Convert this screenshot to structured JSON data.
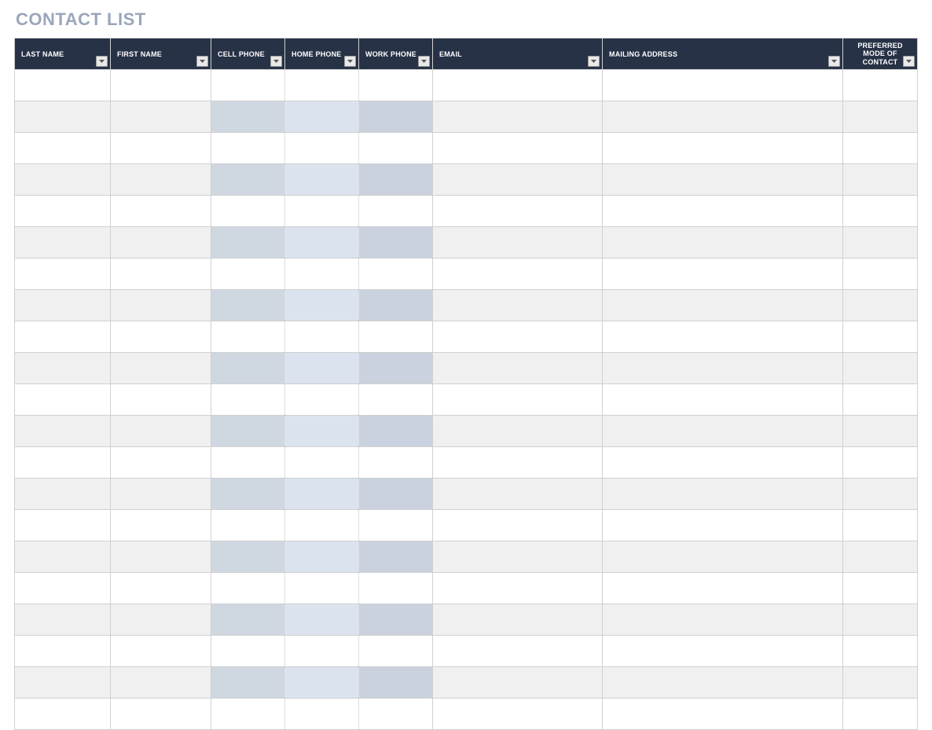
{
  "title": "CONTACT LIST",
  "columns": [
    {
      "key": "last_name",
      "label": "LAST NAME",
      "align": "left",
      "filter": true
    },
    {
      "key": "first_name",
      "label": "FIRST NAME",
      "align": "left",
      "filter": true
    },
    {
      "key": "cell_phone",
      "label": "CELL PHONE",
      "align": "left",
      "filter": true
    },
    {
      "key": "home_phone",
      "label": "HOME PHONE",
      "align": "left",
      "filter": true
    },
    {
      "key": "work_phone",
      "label": "WORK PHONE",
      "align": "left",
      "filter": true
    },
    {
      "key": "email",
      "label": "EMAIL",
      "align": "left",
      "filter": true
    },
    {
      "key": "mailing_address",
      "label": "MAILING ADDRESS",
      "align": "left",
      "filter": true
    },
    {
      "key": "preferred_mode",
      "label": "PREFERRED MODE OF CONTACT",
      "align": "center",
      "filter": true
    }
  ],
  "rows": [
    {
      "last_name": "",
      "first_name": "",
      "cell_phone": "",
      "home_phone": "",
      "work_phone": "",
      "email": "",
      "mailing_address": "",
      "preferred_mode": ""
    },
    {
      "last_name": "",
      "first_name": "",
      "cell_phone": "",
      "home_phone": "",
      "work_phone": "",
      "email": "",
      "mailing_address": "",
      "preferred_mode": ""
    },
    {
      "last_name": "",
      "first_name": "",
      "cell_phone": "",
      "home_phone": "",
      "work_phone": "",
      "email": "",
      "mailing_address": "",
      "preferred_mode": ""
    },
    {
      "last_name": "",
      "first_name": "",
      "cell_phone": "",
      "home_phone": "",
      "work_phone": "",
      "email": "",
      "mailing_address": "",
      "preferred_mode": ""
    },
    {
      "last_name": "",
      "first_name": "",
      "cell_phone": "",
      "home_phone": "",
      "work_phone": "",
      "email": "",
      "mailing_address": "",
      "preferred_mode": ""
    },
    {
      "last_name": "",
      "first_name": "",
      "cell_phone": "",
      "home_phone": "",
      "work_phone": "",
      "email": "",
      "mailing_address": "",
      "preferred_mode": ""
    },
    {
      "last_name": "",
      "first_name": "",
      "cell_phone": "",
      "home_phone": "",
      "work_phone": "",
      "email": "",
      "mailing_address": "",
      "preferred_mode": ""
    },
    {
      "last_name": "",
      "first_name": "",
      "cell_phone": "",
      "home_phone": "",
      "work_phone": "",
      "email": "",
      "mailing_address": "",
      "preferred_mode": ""
    },
    {
      "last_name": "",
      "first_name": "",
      "cell_phone": "",
      "home_phone": "",
      "work_phone": "",
      "email": "",
      "mailing_address": "",
      "preferred_mode": ""
    },
    {
      "last_name": "",
      "first_name": "",
      "cell_phone": "",
      "home_phone": "",
      "work_phone": "",
      "email": "",
      "mailing_address": "",
      "preferred_mode": ""
    },
    {
      "last_name": "",
      "first_name": "",
      "cell_phone": "",
      "home_phone": "",
      "work_phone": "",
      "email": "",
      "mailing_address": "",
      "preferred_mode": ""
    },
    {
      "last_name": "",
      "first_name": "",
      "cell_phone": "",
      "home_phone": "",
      "work_phone": "",
      "email": "",
      "mailing_address": "",
      "preferred_mode": ""
    },
    {
      "last_name": "",
      "first_name": "",
      "cell_phone": "",
      "home_phone": "",
      "work_phone": "",
      "email": "",
      "mailing_address": "",
      "preferred_mode": ""
    },
    {
      "last_name": "",
      "first_name": "",
      "cell_phone": "",
      "home_phone": "",
      "work_phone": "",
      "email": "",
      "mailing_address": "",
      "preferred_mode": ""
    },
    {
      "last_name": "",
      "first_name": "",
      "cell_phone": "",
      "home_phone": "",
      "work_phone": "",
      "email": "",
      "mailing_address": "",
      "preferred_mode": ""
    },
    {
      "last_name": "",
      "first_name": "",
      "cell_phone": "",
      "home_phone": "",
      "work_phone": "",
      "email": "",
      "mailing_address": "",
      "preferred_mode": ""
    },
    {
      "last_name": "",
      "first_name": "",
      "cell_phone": "",
      "home_phone": "",
      "work_phone": "",
      "email": "",
      "mailing_address": "",
      "preferred_mode": ""
    },
    {
      "last_name": "",
      "first_name": "",
      "cell_phone": "",
      "home_phone": "",
      "work_phone": "",
      "email": "",
      "mailing_address": "",
      "preferred_mode": ""
    },
    {
      "last_name": "",
      "first_name": "",
      "cell_phone": "",
      "home_phone": "",
      "work_phone": "",
      "email": "",
      "mailing_address": "",
      "preferred_mode": ""
    },
    {
      "last_name": "",
      "first_name": "",
      "cell_phone": "",
      "home_phone": "",
      "work_phone": "",
      "email": "",
      "mailing_address": "",
      "preferred_mode": ""
    },
    {
      "last_name": "",
      "first_name": "",
      "cell_phone": "",
      "home_phone": "",
      "work_phone": "",
      "email": "",
      "mailing_address": "",
      "preferred_mode": ""
    }
  ]
}
